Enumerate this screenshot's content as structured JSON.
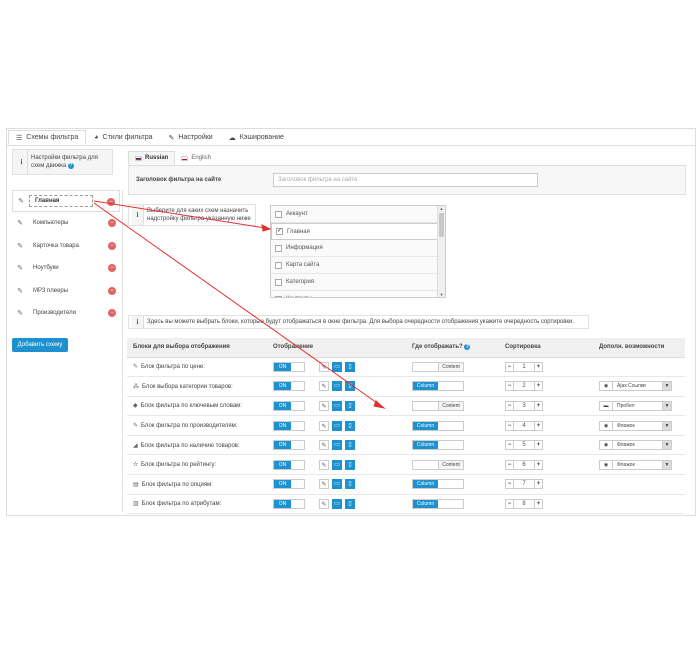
{
  "tabs": [
    {
      "icon": "sliders-icon",
      "glyph": "☰",
      "label": "Схемы фильтра"
    },
    {
      "icon": "palette-icon",
      "glyph": "◕",
      "label": "Стили фильтра"
    },
    {
      "icon": "wrench-icon",
      "glyph": "✎",
      "label": "Настройки"
    },
    {
      "icon": "cloud-icon",
      "glyph": "☁",
      "label": "Кэширование"
    }
  ],
  "sidebar": {
    "info": "Настройки фильтра для схем движка",
    "info_badge": "?",
    "schemes": [
      {
        "label": "Главная",
        "active": true
      },
      {
        "label": "Компьютеры"
      },
      {
        "label": "Карточка товара"
      },
      {
        "label": "Ноутбуки"
      },
      {
        "label": "MP3 плееры"
      },
      {
        "label": "Производители"
      }
    ],
    "add_button": "Добавить схему"
  },
  "lang_tabs": [
    {
      "label": "Russian",
      "flag_color": "#d52b1e"
    },
    {
      "label": "English",
      "flag_color": "#c8102e"
    }
  ],
  "title_field": {
    "label": "Заголовок фильтра на сайте",
    "placeholder": "Заголовок фильтра на сайте"
  },
  "layout_info": "Выберите для каких схем назначить надстройку фильтра указанную ниже",
  "layout_list": [
    {
      "label": "Аккаунт",
      "checked": false
    },
    {
      "label": "Главная",
      "checked": true
    },
    {
      "label": "Информация",
      "checked": false
    },
    {
      "label": "Карта сайта",
      "checked": false
    },
    {
      "label": "Категория",
      "checked": false
    },
    {
      "label": "Контакты",
      "checked": false
    }
  ],
  "blocks_info": "Здесь вы можете выбрать блоки, которые будут отображаться в окне фильтра. Для выбора очередности отображения укажите очередность сортировки.",
  "table": {
    "headers": [
      "Блоки для выбора отображения",
      "Отображение",
      "Где отображать?",
      "Сортировка",
      "Дополн. возможности"
    ],
    "help_badge": "?",
    "toggle_on": "ON",
    "rows": [
      {
        "icon": "✎",
        "name": "Блок фильтра по цене:",
        "where": "Content",
        "sort": "1",
        "extra": null
      },
      {
        "icon": "⁂",
        "name": "Блок выбора категории товаров:",
        "where": "Column",
        "sort": "2",
        "extra": {
          "icon": "◉",
          "label": "Ajax Ссылки"
        }
      },
      {
        "icon": "◆",
        "name": "Блок фильтра по ключевым словам:",
        "where": "Content",
        "sort": "3",
        "extra": {
          "icon": "▬",
          "label": "Пробел"
        }
      },
      {
        "icon": "✎",
        "name": "Блок фильтра по производителям:",
        "where": "Column",
        "sort": "4",
        "extra": {
          "icon": "◉",
          "label": "Флажок"
        }
      },
      {
        "icon": "◢",
        "name": "Блок фильтра по наличию товаров:",
        "where": "Column",
        "sort": "5",
        "extra": {
          "icon": "◉",
          "label": "Флажок"
        }
      },
      {
        "icon": "✫",
        "name": "Блок фильтра по рейтингу:",
        "where": "Content",
        "sort": "6",
        "extra": {
          "icon": "◉",
          "label": "Флажок"
        }
      },
      {
        "icon": "▤",
        "name": "Блок фильтра по опциям:",
        "where": "Column",
        "sort": "7",
        "extra": null
      },
      {
        "icon": "▥",
        "name": "Блок фильтра по атрибутам:",
        "where": "Column",
        "sort": "8",
        "extra": null
      }
    ]
  },
  "colors": {
    "accent": "#1e91cf",
    "danger": "#e26464",
    "annotation": "#e53030"
  }
}
